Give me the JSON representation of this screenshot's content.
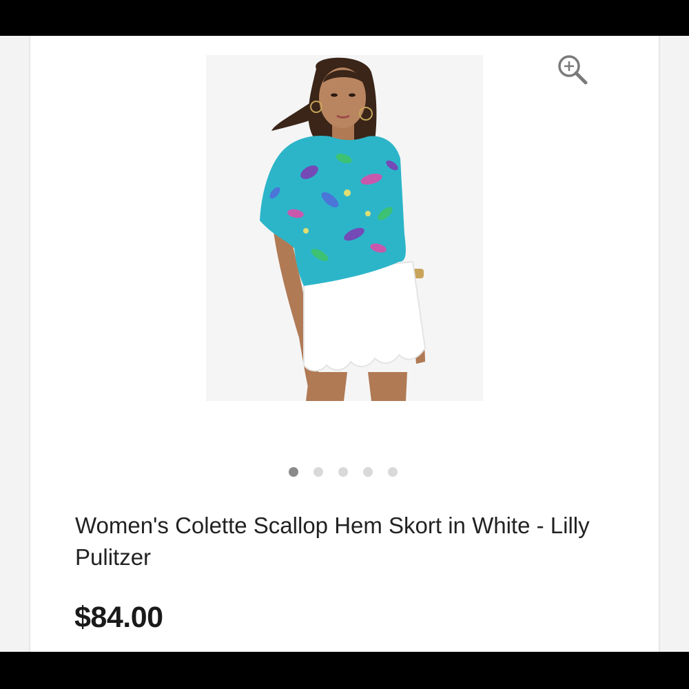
{
  "product": {
    "title": "Women's Colette Scallop Hem Skort in White - Lilly Pulitzer",
    "price": "$84.00",
    "image_alt": "model wearing floral top and white scallop hem skort"
  },
  "gallery": {
    "image_count": 5,
    "active_index": 0
  },
  "icons": {
    "zoom": "zoom-in-icon"
  },
  "colors": {
    "active_dot": "#8a8a8a",
    "inactive_dot": "#d9d9d9",
    "title_text": "#222222",
    "price_text": "#1a1a1a"
  }
}
